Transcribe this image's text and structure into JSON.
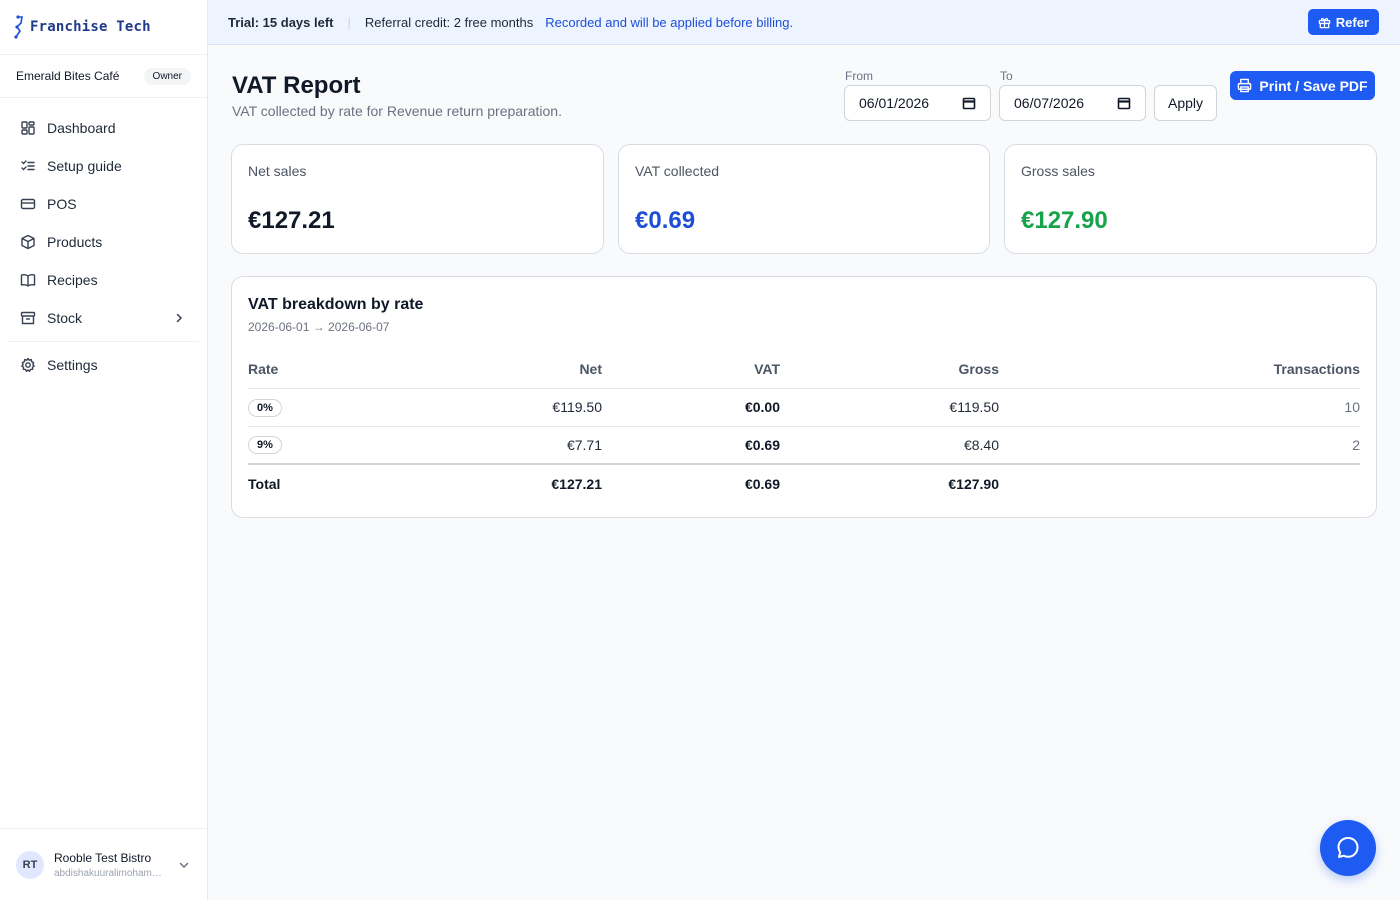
{
  "brand": {
    "name": "Franchise Tech"
  },
  "org": {
    "name": "Emerald Bites Café",
    "role": "Owner"
  },
  "nav": [
    {
      "label": "Dashboard",
      "icon": "dashboard-icon"
    },
    {
      "label": "Setup guide",
      "icon": "checklist-icon"
    },
    {
      "label": "POS",
      "icon": "card-icon"
    },
    {
      "label": "Products",
      "icon": "box-icon"
    },
    {
      "label": "Recipes",
      "icon": "book-icon"
    },
    {
      "label": "Stock",
      "icon": "archive-icon"
    },
    {
      "label": "Settings",
      "icon": "gear-icon"
    }
  ],
  "user": {
    "initials": "RT",
    "name": "Rooble Test Bistro",
    "email": "abdishakuuralimohamed@gmail.com"
  },
  "banner": {
    "trial": "Trial: 15 days left",
    "credit": "Referral credit: 2 free months",
    "note": "Recorded and will be applied before billing.",
    "refer_label": "Refer"
  },
  "header": {
    "title": "VAT Report",
    "subtitle": "VAT collected by rate for Revenue return preparation.",
    "from_label": "From",
    "from_value": "06/01/2026",
    "to_label": "To",
    "to_value": "06/07/2026",
    "apply_label": "Apply",
    "print_label": "Print / Save PDF"
  },
  "stats": [
    {
      "label": "Net sales",
      "value": "€127.21",
      "color": "#111827"
    },
    {
      "label": "VAT collected",
      "value": "€0.69",
      "color": "#1d4ed8"
    },
    {
      "label": "Gross sales",
      "value": "€127.90",
      "color": "#16a34a"
    }
  ],
  "breakdown": {
    "title": "VAT breakdown by rate",
    "range": "2026-06-01 → 2026-06-07",
    "columns": [
      "Rate",
      "Net",
      "VAT",
      "Gross",
      "Transactions"
    ],
    "rows": [
      {
        "rate": "0%",
        "net": "€119.50",
        "vat": "€0.00",
        "gross": "€119.50",
        "transactions": "10"
      },
      {
        "rate": "9%",
        "net": "€7.71",
        "vat": "€0.69",
        "gross": "€8.40",
        "transactions": "2"
      }
    ],
    "total": {
      "label": "Total",
      "net": "€127.21",
      "vat": "€0.69",
      "gross": "€127.90"
    }
  }
}
